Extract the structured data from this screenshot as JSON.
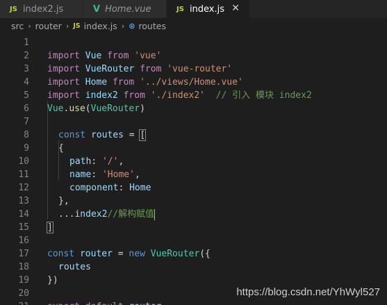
{
  "tabs": [
    {
      "icon": "JS",
      "label": "index2.js"
    },
    {
      "icon": "V",
      "label": "Home.vue"
    },
    {
      "icon": "JS",
      "label": "index.js",
      "close": "✕"
    }
  ],
  "breadcrumb": {
    "src": "src",
    "router": "router",
    "file": "index.js",
    "symbol": "routes",
    "file_icon": "JS",
    "sep": "›",
    "symbol_icon": "⊛"
  },
  "lines": [
    {
      "n": "1"
    },
    {
      "n": "2"
    },
    {
      "n": "3"
    },
    {
      "n": "4"
    },
    {
      "n": "5"
    },
    {
      "n": "6"
    },
    {
      "n": "7"
    },
    {
      "n": "8"
    },
    {
      "n": "9"
    },
    {
      "n": "10"
    },
    {
      "n": "11"
    },
    {
      "n": "12"
    },
    {
      "n": "13"
    },
    {
      "n": "14"
    },
    {
      "n": "15"
    },
    {
      "n": "16"
    },
    {
      "n": "17"
    },
    {
      "n": "18"
    },
    {
      "n": "19"
    },
    {
      "n": "20"
    },
    {
      "n": "21"
    }
  ],
  "code": {
    "l1": {
      "kw": "import",
      "id": "Vue",
      "from": "from",
      "st": "'vue'"
    },
    "l2": {
      "kw": "import",
      "id": "VueRouter",
      "from": "from",
      "st": "'vue-router'"
    },
    "l3": {
      "kw": "import",
      "id": "Home",
      "from": "from",
      "st": "'../views/Home.vue'"
    },
    "l4": {
      "kw": "import",
      "id": "index2",
      "from": "from",
      "st": "'./index2'",
      "cm": "// 引入 模块 index2"
    },
    "l5": {
      "obj": "Vue",
      "dot": ".",
      "fn": "use",
      "open": "(",
      "arg": "VueRouter",
      "close": ")"
    },
    "l7": {
      "kw": "const",
      "id": "routes",
      "eq": " = ",
      "br": "["
    },
    "l8": {
      "br": "{"
    },
    "l9": {
      "key": "path",
      "colon": ": ",
      "st": "'/'",
      "comma": ","
    },
    "l10": {
      "key": "name",
      "colon": ": ",
      "st": "'Home'",
      "comma": ","
    },
    "l11": {
      "key": "component",
      "colon": ": ",
      "val": "Home"
    },
    "l12": {
      "close": "},"
    },
    "l13": {
      "spread": "...",
      "id": "index2",
      "cm": "//解构赋值"
    },
    "l14": {
      "br": "]"
    },
    "l16": {
      "kw": "const",
      "id": "router",
      "eq": " = ",
      "nw": "new",
      "cls": "VueRouter",
      "open": "({"
    },
    "l17": {
      "id": "routes"
    },
    "l18": {
      "close": "})"
    },
    "l20": {
      "kw": "export",
      "def": "default",
      "id": "router"
    }
  },
  "watermark": "https://blog.csdn.net/YhWyl527"
}
